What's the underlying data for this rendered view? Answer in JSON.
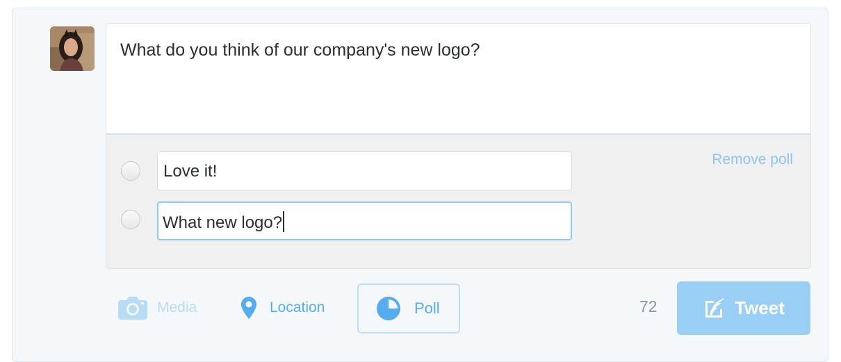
{
  "composer": {
    "text": "What do you think of our company's new logo?"
  },
  "poll": {
    "choices": [
      {
        "value": "Love it!"
      },
      {
        "value": "What new logo?"
      }
    ],
    "remove_label": "Remove poll"
  },
  "toolbar": {
    "media_label": "Media",
    "location_label": "Location",
    "poll_label": "Poll",
    "char_count": "72",
    "tweet_label": "Tweet"
  },
  "colors": {
    "accent": "#55acee",
    "accent_light": "#8ec5ee",
    "tweet_button": "#99cff4",
    "poll_background": "#f0f0f0",
    "page_background": "#f5f8fa"
  },
  "icons": {
    "media": "camera-icon",
    "location": "location-pin-icon",
    "poll": "pie-chart-icon",
    "tweet": "quill-icon"
  }
}
